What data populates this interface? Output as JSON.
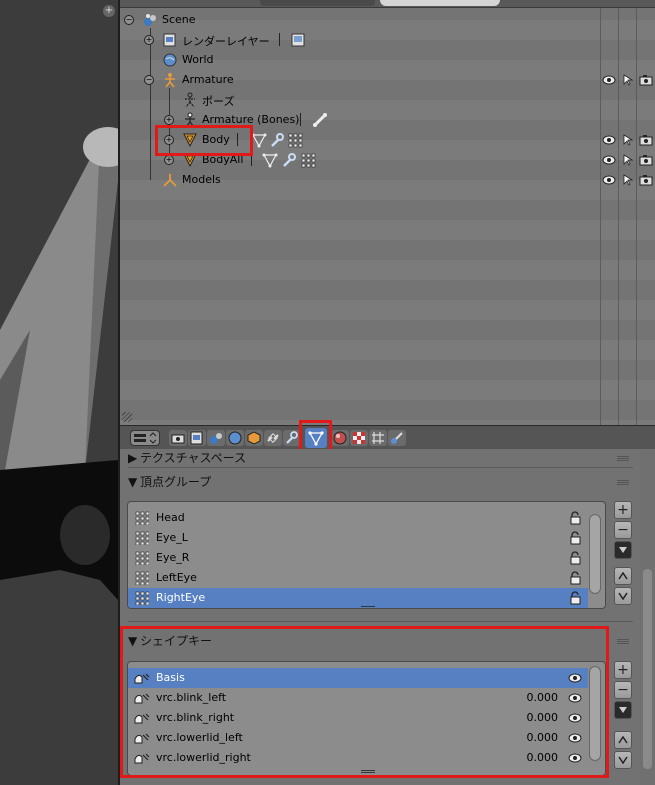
{
  "viewport": {
    "plus_icon": "+"
  },
  "outliner": {
    "rows": [
      {
        "label": "Scene",
        "icon": "scene-icon"
      },
      {
        "label": "レンダーレイヤー",
        "icon": "render-layer-icon"
      },
      {
        "label": "World",
        "icon": "world-icon"
      },
      {
        "label": "Armature",
        "icon": "armature-icon"
      },
      {
        "label": "ポーズ",
        "icon": "pose-icon"
      },
      {
        "label": "Armature (Bones)",
        "icon": "armature-data-icon"
      },
      {
        "label": "Body",
        "icon": "mesh-icon"
      },
      {
        "label": "BodyAll",
        "icon": "mesh-icon"
      },
      {
        "label": "Models",
        "icon": "empty-icon"
      }
    ]
  },
  "properties": {
    "texture_space_panel": "テクスチャスペース",
    "vertex_groups_panel": "頂点グループ",
    "vertex_groups": [
      "Head",
      "Eye_L",
      "Eye_R",
      "LeftEye",
      "RightEye"
    ],
    "selected_vertex_group": "RightEye",
    "shape_keys_panel": "シェイプキー",
    "shape_keys": [
      {
        "name": "Basis",
        "value": ""
      },
      {
        "name": "vrc.blink_left",
        "value": "0.000"
      },
      {
        "name": "vrc.blink_right",
        "value": "0.000"
      },
      {
        "name": "vrc.lowerlid_left",
        "value": "0.000"
      },
      {
        "name": "vrc.lowerlid_right",
        "value": "0.000"
      }
    ],
    "selected_shape_key": "Basis",
    "panel_expanded_glyph": "▼",
    "panel_collapsed_glyph": "▶"
  },
  "colors": {
    "selection": "#5680c2",
    "highlight_box": "#e11919",
    "mesh_icon": "#e8a030"
  }
}
